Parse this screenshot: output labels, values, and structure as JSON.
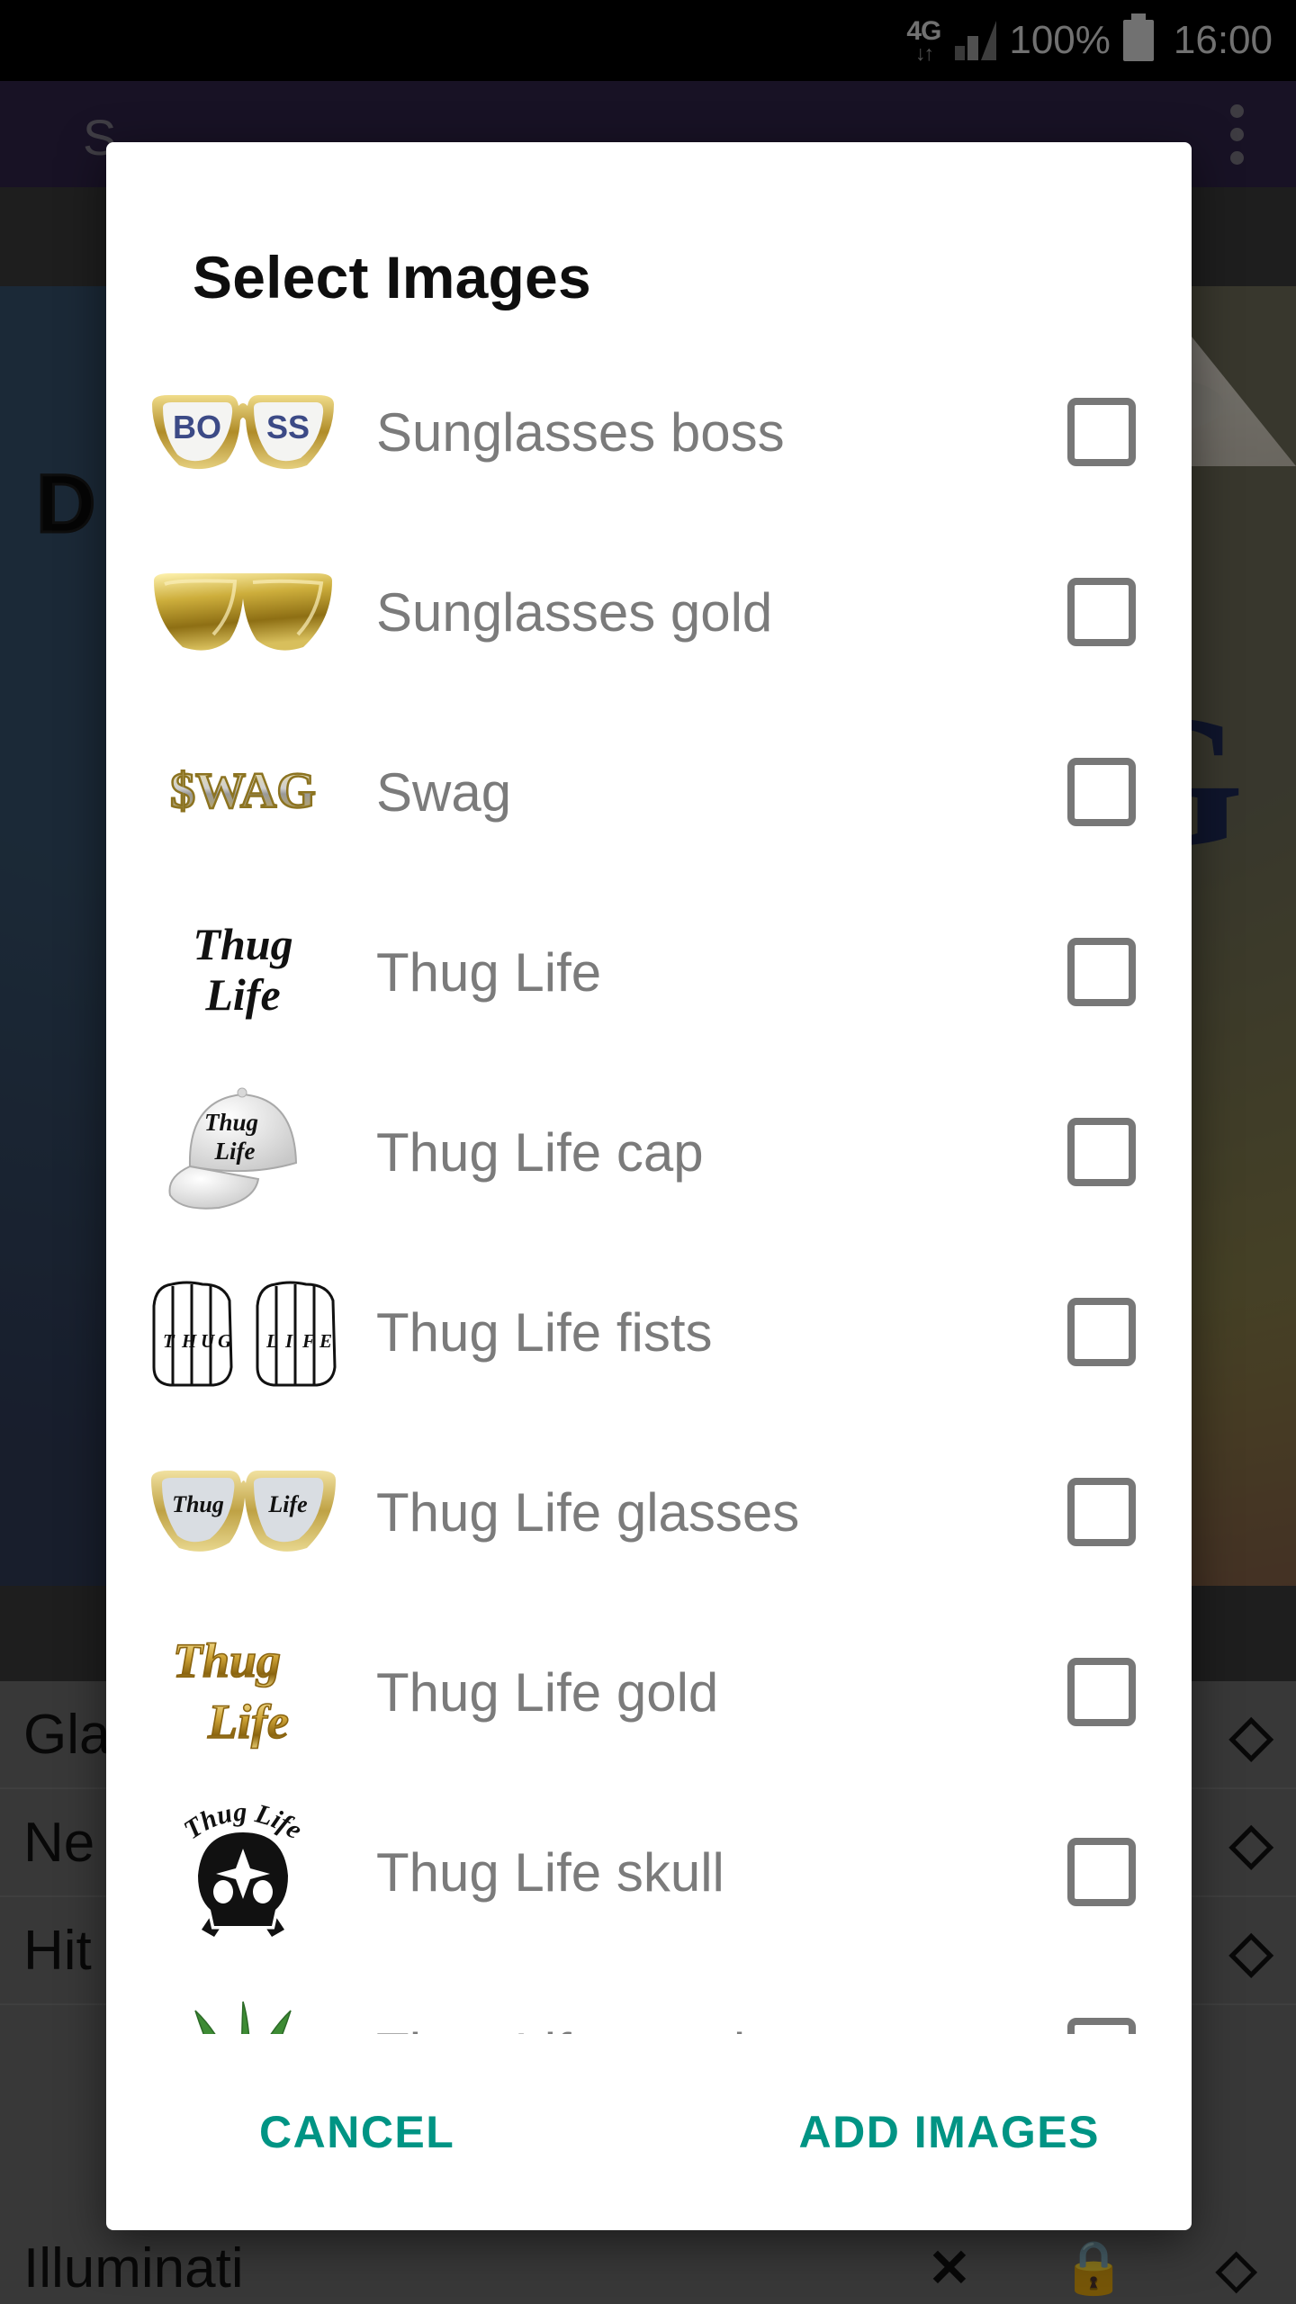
{
  "status_bar": {
    "network": "4G",
    "data_arrows": "↓↑",
    "signal_icon": "signal-bars-icon",
    "battery_percent": "100%",
    "battery_icon": "battery-full-icon",
    "time": "16:00"
  },
  "app": {
    "title": "S",
    "overflow_icon": "overflow-menu-icon",
    "background_text": "DE",
    "background_letter": "G"
  },
  "dialog": {
    "title": "Select Images",
    "items": [
      {
        "label": "Sunglasses boss",
        "thumb": "sunglasses-boss-icon",
        "checked": false
      },
      {
        "label": "Sunglasses gold",
        "thumb": "sunglasses-gold-icon",
        "checked": false
      },
      {
        "label": "Swag",
        "thumb": "swag-icon",
        "checked": false
      },
      {
        "label": "Thug Life",
        "thumb": "thug-life-text-icon",
        "checked": false
      },
      {
        "label": "Thug Life cap",
        "thumb": "thug-life-cap-icon",
        "checked": false
      },
      {
        "label": "Thug Life fists",
        "thumb": "thug-life-fists-icon",
        "checked": false
      },
      {
        "label": "Thug Life glasses",
        "thumb": "thug-life-glasses-icon",
        "checked": false
      },
      {
        "label": "Thug Life gold",
        "thumb": "thug-life-gold-icon",
        "checked": false
      },
      {
        "label": "Thug Life skull",
        "thumb": "thug-life-skull-icon",
        "checked": false
      },
      {
        "label": "Thug Life weed",
        "thumb": "thug-life-weed-icon",
        "checked": false
      }
    ],
    "cancel_label": "CANCEL",
    "confirm_label": "ADD IMAGES",
    "accent_color": "#009484",
    "label_color": "#7b7b7b",
    "checkbox_color": "#777777"
  },
  "background_list": {
    "rows": [
      {
        "label": "Gla",
        "chevron": "chevron-expand-icon"
      },
      {
        "label": "Ne",
        "chevron": "chevron-expand-icon"
      },
      {
        "label": "Hit",
        "chevron": "chevron-expand-icon"
      }
    ],
    "last_row": {
      "label": "Illuminati",
      "icons": [
        "close-icon",
        "lock-icon",
        "chevron-expand-icon"
      ]
    }
  },
  "thumb_text": {
    "boss": "BOSS",
    "swag": "$WAG",
    "thug": "Thug",
    "life": "Life",
    "thug_life": "Thug Life",
    "knuckles_left": "THUG",
    "knuckles_right": "LIFE"
  }
}
